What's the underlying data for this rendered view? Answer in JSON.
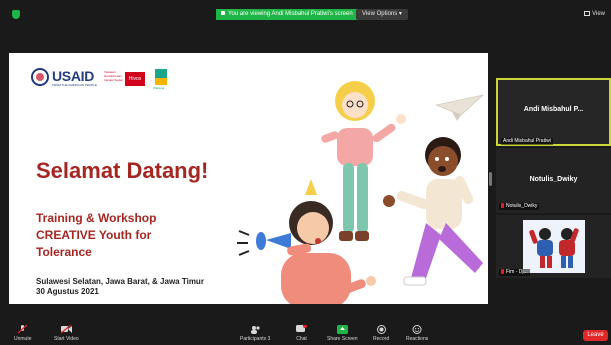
{
  "topbar": {
    "screen_banner": "You are viewing Andi Misbahul Pratiwi's screen",
    "view_options": "View Options",
    "view_label": "View"
  },
  "slide": {
    "usaid": "USAID",
    "usaid_tagline": "FROM THE AMERICAN PEOPLE",
    "partner_text": "Yayasan Humanis dan Inovasi Sosial",
    "hivos": "Hivos",
    "partner2_text": "Wahana",
    "title": "Selamat Datang!",
    "subtitle_lines": [
      "Training & Workshop",
      "CREATIVE Youth for",
      "Tolerance"
    ],
    "location": "Sulawesi Selatan, Jawa Barat, & Jawa Timur",
    "date": "30 Agustus 2021"
  },
  "participants": [
    {
      "display_name": "Andi Misbahul P...",
      "label": "Andi Misbahul Pratiwi"
    },
    {
      "display_name": "Notulis_Dwiky",
      "label": "Notulis_Dwiky"
    },
    {
      "label": "Fim - Dj..."
    }
  ],
  "toolbar": {
    "unmute": "Unmute",
    "start_video": "Start Video",
    "participants": "Participants",
    "participants_count": "3",
    "chat": "Chat",
    "chat_badge": "2",
    "share_screen": "Share Screen",
    "record": "Record",
    "reactions": "Reactions",
    "leave": "Leave"
  },
  "colors": {
    "share_green": "#1fb546",
    "active_speaker": "#c9d73a",
    "leave_red": "#e02828",
    "title_red": "#a52722"
  }
}
